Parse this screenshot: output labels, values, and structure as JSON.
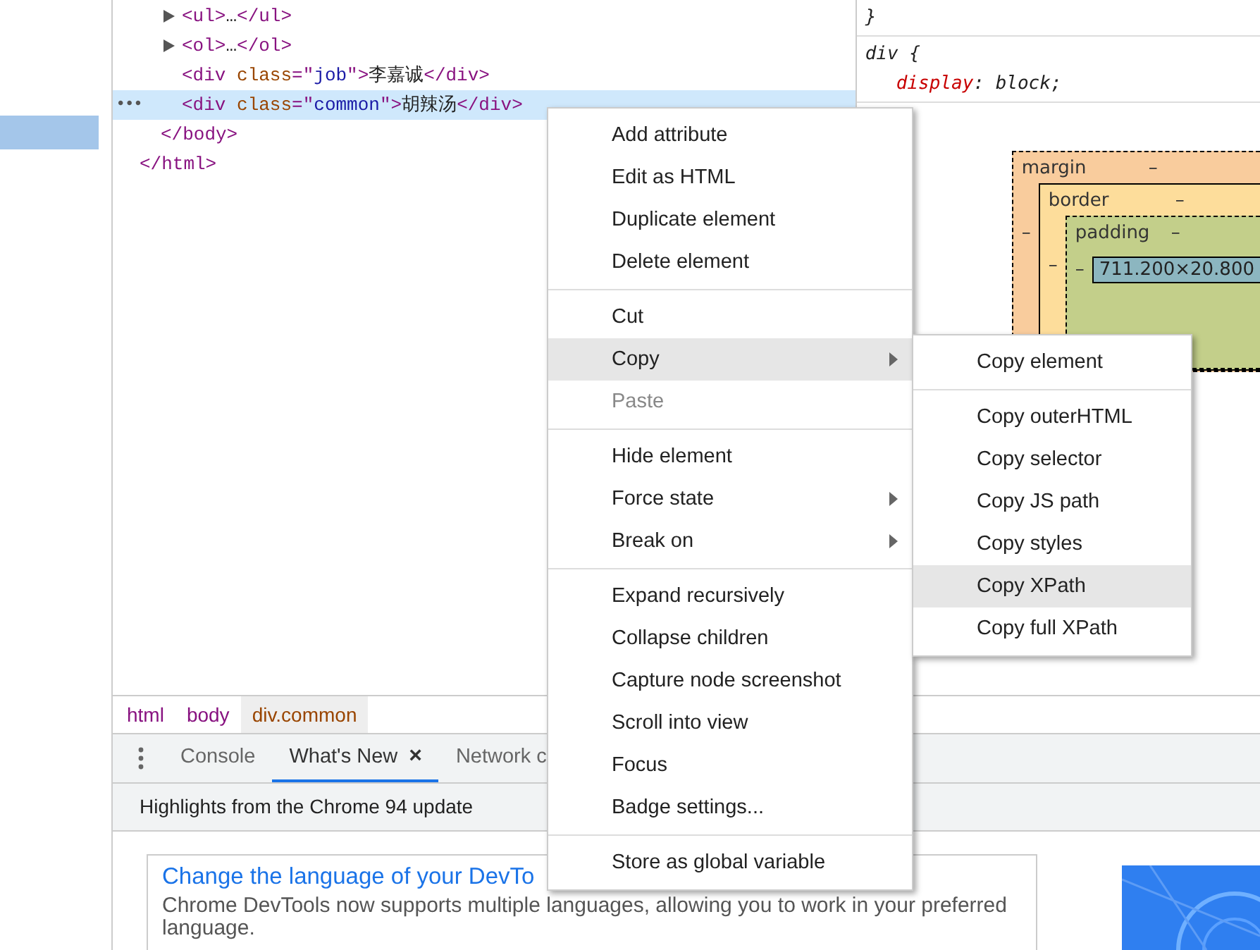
{
  "dom_tree": [
    {
      "close": [
        {
          "kind": "tag",
          "text": "</html>"
        }
      ],
      "children": [
        {
          "close": [
            {
              "kind": "tag",
              "text": "</body>"
            }
          ],
          "children": [
            {
              "expandable": true,
              "selected": false,
              "tokens": [
                {
                  "kind": "tag",
                  "text": "<ul>"
                },
                {
                  "kind": "text",
                  "text": "…"
                },
                {
                  "kind": "tag",
                  "text": "</ul>"
                }
              ]
            },
            {
              "expandable": true,
              "selected": false,
              "tokens": [
                {
                  "kind": "tag",
                  "text": "<ol>"
                },
                {
                  "kind": "text",
                  "text": "…"
                },
                {
                  "kind": "tag",
                  "text": "</ol>"
                }
              ]
            },
            {
              "expandable": false,
              "selected": false,
              "tokens": [
                {
                  "kind": "tag",
                  "text": "<div"
                },
                {
                  "kind": "attr",
                  "text": " class"
                },
                {
                  "kind": "tag",
                  "text": "=\""
                },
                {
                  "kind": "value",
                  "text": "job"
                },
                {
                  "kind": "tag",
                  "text": "\">"
                },
                {
                  "kind": "text",
                  "text": "李嘉诚"
                },
                {
                  "kind": "tag",
                  "text": "</div>"
                }
              ]
            },
            {
              "expandable": false,
              "selected": true,
              "tokens": [
                {
                  "kind": "tag",
                  "text": "<div"
                },
                {
                  "kind": "attr",
                  "text": " class"
                },
                {
                  "kind": "tag",
                  "text": "=\""
                },
                {
                  "kind": "value",
                  "text": "common"
                },
                {
                  "kind": "tag",
                  "text": "\">"
                },
                {
                  "kind": "text",
                  "text": "胡辣汤"
                },
                {
                  "kind": "tag",
                  "text": "</div>"
                }
              ]
            }
          ]
        }
      ]
    }
  ],
  "selected_row_menu": "•••",
  "styles": {
    "closing_brace": "}",
    "rule": {
      "selector": "div {",
      "property": "display",
      "separator": ": ",
      "value": "block;"
    }
  },
  "box_model": {
    "margin": {
      "label": "margin",
      "value": "–",
      "left": "–"
    },
    "border": {
      "label": "border",
      "value": "–",
      "left": "–"
    },
    "padding": {
      "label": "padding",
      "value": "–",
      "left": "–"
    },
    "content": "711.200×20.800"
  },
  "breadcrumbs": [
    {
      "label": "html",
      "selected": false
    },
    {
      "label": "body",
      "selected": false
    },
    {
      "label": "div.common",
      "selected": true
    }
  ],
  "drawer_tabs": [
    {
      "label": "Console",
      "selected": false,
      "closable": false
    },
    {
      "label": "What's New",
      "selected": true,
      "closable": true,
      "close": "×"
    },
    {
      "label": "Network c",
      "selected": false,
      "closable": false
    }
  ],
  "drawer_header": "Highlights from the Chrome 94 update",
  "news_card": {
    "title": "Change the language of your DevTo",
    "body": "Chrome DevTools now supports multiple languages, allowing you to work in your preferred language."
  },
  "context_menu": [
    [
      {
        "label": "Add attribute",
        "disabled": false,
        "submenu": false,
        "highlighted": false
      },
      {
        "label": "Edit as HTML",
        "disabled": false,
        "submenu": false,
        "highlighted": false
      },
      {
        "label": "Duplicate element",
        "disabled": false,
        "submenu": false,
        "highlighted": false
      },
      {
        "label": "Delete element",
        "disabled": false,
        "submenu": false,
        "highlighted": false
      }
    ],
    [
      {
        "label": "Cut",
        "disabled": false,
        "submenu": false,
        "highlighted": false
      },
      {
        "label": "Copy",
        "disabled": false,
        "submenu": true,
        "highlighted": true
      },
      {
        "label": "Paste",
        "disabled": true,
        "submenu": false,
        "highlighted": false
      }
    ],
    [
      {
        "label": "Hide element",
        "disabled": false,
        "submenu": false,
        "highlighted": false
      },
      {
        "label": "Force state",
        "disabled": false,
        "submenu": true,
        "highlighted": false
      },
      {
        "label": "Break on",
        "disabled": false,
        "submenu": true,
        "highlighted": false
      }
    ],
    [
      {
        "label": "Expand recursively",
        "disabled": false,
        "submenu": false,
        "highlighted": false
      },
      {
        "label": "Collapse children",
        "disabled": false,
        "submenu": false,
        "highlighted": false
      },
      {
        "label": "Capture node screenshot",
        "disabled": false,
        "submenu": false,
        "highlighted": false
      },
      {
        "label": "Scroll into view",
        "disabled": false,
        "submenu": false,
        "highlighted": false
      },
      {
        "label": "Focus",
        "disabled": false,
        "submenu": false,
        "highlighted": false
      },
      {
        "label": "Badge settings...",
        "disabled": false,
        "submenu": false,
        "highlighted": false
      }
    ],
    [
      {
        "label": "Store as global variable",
        "disabled": false,
        "submenu": false,
        "highlighted": false
      }
    ]
  ],
  "copy_submenu": [
    [
      {
        "label": "Copy element",
        "highlighted": false
      }
    ],
    [
      {
        "label": "Copy outerHTML",
        "highlighted": false
      },
      {
        "label": "Copy selector",
        "highlighted": false
      },
      {
        "label": "Copy JS path",
        "highlighted": false
      },
      {
        "label": "Copy styles",
        "highlighted": false
      },
      {
        "label": "Copy XPath",
        "highlighted": true
      },
      {
        "label": "Copy full XPath",
        "highlighted": false
      }
    ]
  ]
}
